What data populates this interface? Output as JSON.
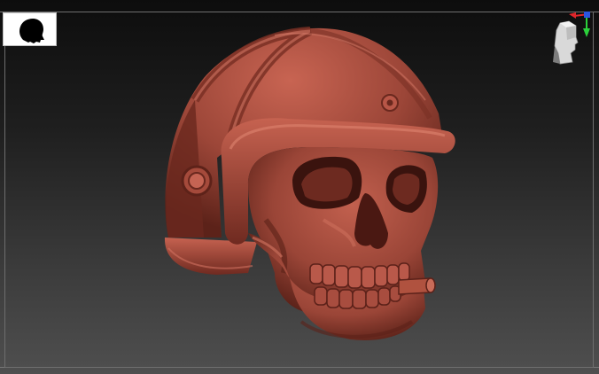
{
  "viewport": {
    "background_top": "#0d0d0d",
    "background_bottom": "#4f4f4f",
    "frame_color": "#6e6e6e"
  },
  "thumbnail": {
    "icon": "head-silhouette-icon",
    "background": "#ffffff",
    "silhouette_color": "#000000"
  },
  "navigation_gizmo": {
    "icon": "orientation-head-icon",
    "axis_x_color": "#e0262b",
    "axis_y_color": "#2bd13b",
    "axis_z_color": "#2b55e0"
  },
  "model": {
    "icon": "skull-helmet-sculpt",
    "material_color": "#a64a3d"
  }
}
